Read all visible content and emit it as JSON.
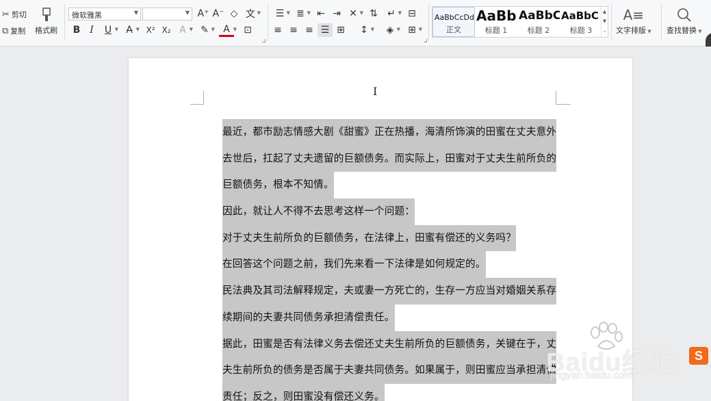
{
  "ribbon": {
    "clipboard": {
      "cut": "剪切",
      "copy": "复制",
      "format_painter": "格式刷"
    },
    "font": {
      "family": "微软雅黑",
      "size": ""
    },
    "styles": [
      {
        "sample": "AaBbCcDd",
        "name": "正文"
      },
      {
        "sample": "AaBb",
        "name": "标题 1"
      },
      {
        "sample": "AaBbC",
        "name": "标题 2"
      },
      {
        "sample": "AaBbC",
        "name": "标题 3"
      }
    ],
    "text_layout": "文字排版",
    "find_replace": "查找替换"
  },
  "document": {
    "lines": [
      "最近，都市励志情感大剧《甜蜜》正在热播，海清所饰演的田蜜在丈夫意外",
      "去世后，扛起了丈夫遗留的巨额债务。而实际上，田蜜对于丈夫生前所负的",
      "巨额债务，根本不知情。",
      "因此，就让人不得不去思考这样一个问题：",
      "对于丈夫生前所负的巨额债务，在法律上，田蜜有偿还的义务吗？",
      "在回答这个问题之前，我们先来看一下法律是如何规定的。",
      "民法典及其司法解释规定，夫或妻一方死亡的，生存一方应当对婚姻关系存",
      "续期间的夫妻共同债务承担清偿责任。",
      "据此，田蜜是否有法律义务去偿还丈夫生前所负的巨额债务，关键在于，丈",
      "夫生前所负的债务是否属于夫妻共同债务。如果属于，则田蜜应当承担清偿",
      "责任；反之，则田蜜没有偿还义务。"
    ]
  },
  "watermark": {
    "logo": "Baidu经验",
    "url": "jingyan.baidu.com"
  },
  "sogou": "S"
}
